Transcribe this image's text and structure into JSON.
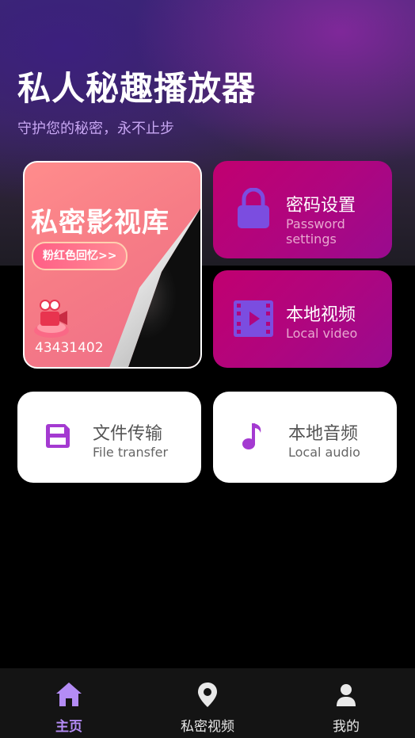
{
  "header": {
    "title": "私人秘趣播放器",
    "subtitle": "守护您的秘密，永不止步"
  },
  "promo": {
    "title": "私密影视库",
    "pill": "粉红色回忆>>",
    "number": "43431402"
  },
  "cards": {
    "password": {
      "label": "密码设置",
      "sub": "Password settings",
      "icon": "lock-icon"
    },
    "local_video": {
      "label": "本地视频",
      "sub": "Local video",
      "icon": "film-icon"
    },
    "file_transfer": {
      "label": "文件传输",
      "sub": "File transfer",
      "icon": "floppy-icon"
    },
    "local_audio": {
      "label": "本地音频",
      "sub": "Local audio",
      "icon": "music-note-icon"
    }
  },
  "nav": {
    "home": "主页",
    "private_video": "私密视频",
    "mine": "我的"
  },
  "colors": {
    "accent_purple": "#b48cf5",
    "icon_purple": "#7b4de0",
    "card_magenta": "#b0057e",
    "white_card_icon": "#a43ad1"
  }
}
